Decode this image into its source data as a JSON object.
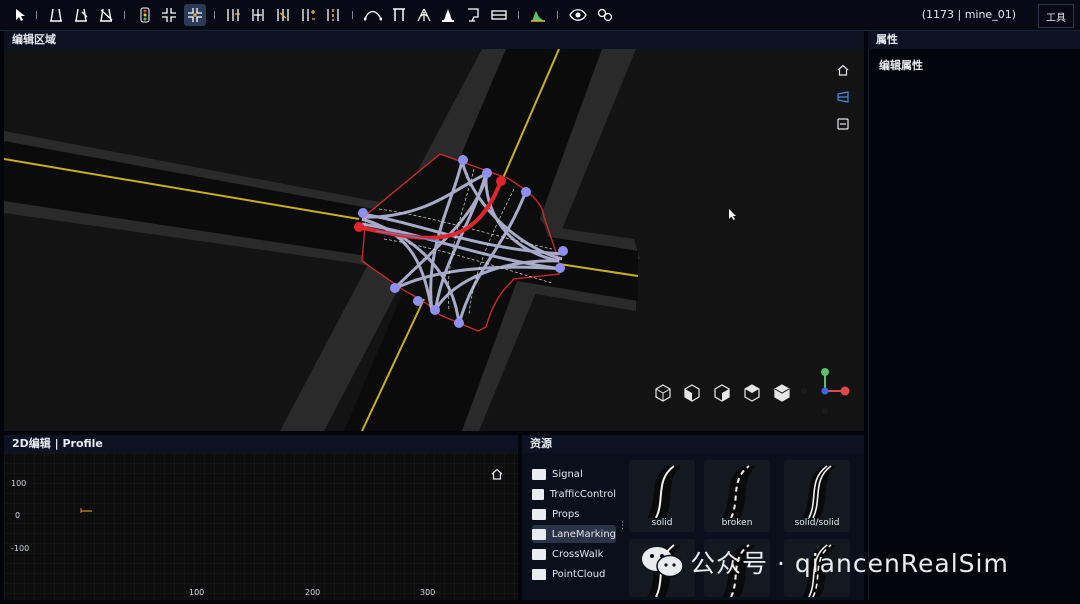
{
  "toolbar": {
    "icons": [
      "cursor-icon",
      "road-icon",
      "road-edit-icon",
      "road-delete-icon",
      "traffic-light-icon",
      "junction-icon",
      "junction-active-icon",
      "lane-add-icon",
      "lane-split-icon",
      "lane-merge-icon",
      "lane-width-icon",
      "lane-marking-icon",
      "curve-icon",
      "bridge-icon",
      "tree-icon",
      "cone-icon",
      "sign-icon",
      "barrier-icon",
      "terrain-icon",
      "eye-icon",
      "link-icon"
    ],
    "status": "(1173 | mine_01)",
    "tools_label": "工具"
  },
  "editor": {
    "title": "编辑区域"
  },
  "properties": {
    "title": "属性",
    "section_label": "编辑属性"
  },
  "profile": {
    "title": "2D编辑 | Profile",
    "y_ticks": [
      "100",
      "0",
      "-100"
    ],
    "x_ticks": [
      "100",
      "200",
      "300"
    ]
  },
  "assets": {
    "title": "资源",
    "folders": [
      "Signal",
      "TrafficControl",
      "Props",
      "LaneMarking",
      "CrossWalk",
      "PointCloud"
    ],
    "selected_folder": "LaneMarking",
    "tiles": [
      "solid",
      "broken",
      "solid/solid"
    ]
  },
  "watermark": "公众号 · qiancenRealSim",
  "colors": {
    "accent_blue": "#8f8ff0",
    "select_red": "#e0262a",
    "lane_yellow": "#c8b022"
  }
}
